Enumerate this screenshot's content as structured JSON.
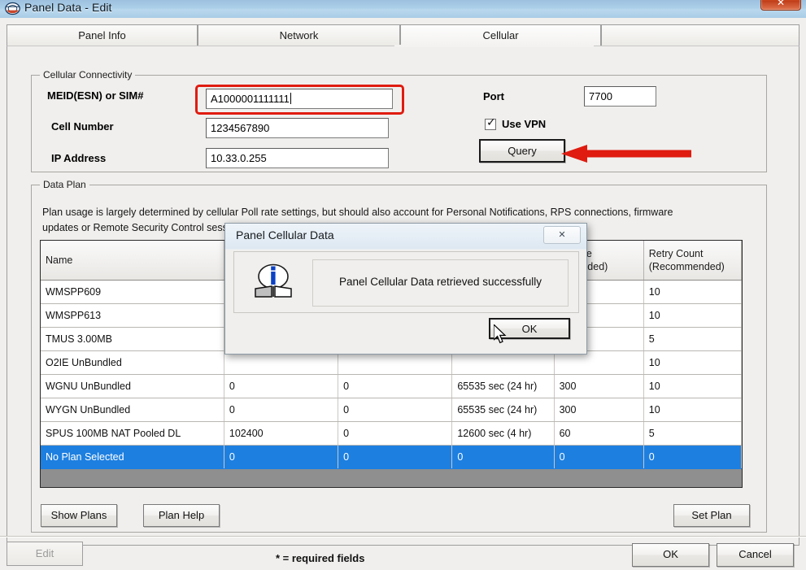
{
  "window": {
    "title": "Panel Data - Edit",
    "close_label": "✕",
    "app_icon": "rps-logo-icon"
  },
  "tabs": [
    {
      "label": "Panel Info",
      "active": false
    },
    {
      "label": "Network",
      "active": false
    },
    {
      "label": "Cellular",
      "active": true
    }
  ],
  "cellular_connectivity": {
    "legend": "Cellular Connectivity",
    "fields": [
      {
        "label": "MEID(ESN) or SIM#",
        "value": "A1000001111111",
        "focused": true
      },
      {
        "label": "Cell Number",
        "value": "1234567890",
        "focused": false
      },
      {
        "label": "IP Address",
        "value": "10.33.0.255",
        "focused": false
      }
    ],
    "port": {
      "label": "Port",
      "value": "7700"
    },
    "use_vpn": {
      "label": "Use VPN",
      "checked": true
    },
    "query_button": "Query"
  },
  "data_plan": {
    "legend": "Data Plan",
    "description_line1": "Plan usage is largely determined by cellular Poll rate settings, but should also account for Personal Notifications, RPS connections, firmware",
    "description_line2": "updates or Remote Security Control sessions. See Plan Help to avoid overage charges.",
    "columns": [
      "Name",
      "",
      "",
      "",
      "ait time\n mmended)",
      "Retry Count\n(Recommended)"
    ],
    "column_header_name": "Name",
    "column_header_wait_time_l1": "ait time",
    "column_header_wait_time_l2": "mmended)",
    "column_header_retry_l1": "Retry Count",
    "column_header_retry_l2": "(Recommended)",
    "rows": [
      {
        "name": "WMSPP609",
        "c1": "",
        "c2": "",
        "c3": "",
        "c4": "",
        "retry": "10",
        "selected": false
      },
      {
        "name": "WMSPP613",
        "c1": "",
        "c2": "",
        "c3": "",
        "c4": "",
        "retry": "10",
        "selected": false
      },
      {
        "name": "TMUS 3.00MB",
        "c1": "",
        "c2": "",
        "c3": "",
        "c4": "",
        "retry": "5",
        "selected": false
      },
      {
        "name": "O2IE UnBundled",
        "c1": "",
        "c2": "",
        "c3": "",
        "c4": "",
        "retry": "10",
        "selected": false
      },
      {
        "name": "WGNU UnBundled",
        "c1": "0",
        "c2": "0",
        "c3": "65535 sec (24 hr)",
        "c4": "300",
        "retry": "10",
        "selected": false
      },
      {
        "name": "WYGN UnBundled",
        "c1": "0",
        "c2": "0",
        "c3": "65535 sec (24 hr)",
        "c4": "300",
        "retry": "10",
        "selected": false
      },
      {
        "name": "SPUS 100MB NAT Pooled DL",
        "c1": "102400",
        "c2": "0",
        "c3": "12600 sec (4 hr)",
        "c4": "60",
        "retry": "5",
        "selected": false
      },
      {
        "name": "No Plan Selected",
        "c1": "0",
        "c2": "0",
        "c3": "0",
        "c4": "0",
        "retry": "0",
        "selected": true
      }
    ],
    "buttons": {
      "show_plans": "Show Plans",
      "plan_help": "Plan Help",
      "set_plan": "Set Plan"
    }
  },
  "dialog": {
    "title": "Panel Cellular Data",
    "close_label": "✕",
    "message": "Panel Cellular Data retrieved successfully",
    "ok_label": "OK",
    "icon": "info-icon"
  },
  "footer": {
    "edit_label": "Edit",
    "required_note": "* = required fields",
    "ok_label": "OK",
    "cancel_label": "Cancel"
  },
  "colors": {
    "selection_blue": "#1d7fe0",
    "highlight_red": "#e01b10",
    "arrow_red": "#e01b10",
    "title_blue": "#accfe8"
  }
}
